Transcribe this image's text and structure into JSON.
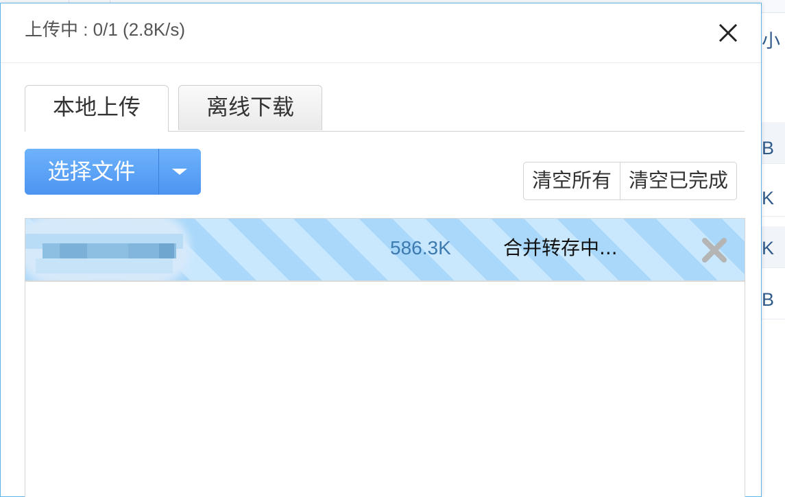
{
  "background": {
    "header_text": "小",
    "rows": [
      {
        "text": "B"
      },
      {
        "text": "K"
      },
      {
        "text": "K"
      },
      {
        "text": "B"
      }
    ]
  },
  "dialog": {
    "title": "上传中 : 0/1 (2.8K/s)",
    "close_icon": "close-icon"
  },
  "tabs": [
    {
      "label": "本地上传",
      "active": true
    },
    {
      "label": "离线下载",
      "active": false
    }
  ],
  "toolbar": {
    "choose_file_label": "选择文件",
    "dropdown_icon": "caret-down-icon",
    "clear_all_label": "清空所有",
    "clear_done_label": "清空已完成"
  },
  "files": [
    {
      "size": "586.3K",
      "status": "合并转存中...",
      "remove_icon": "remove-icon"
    }
  ],
  "colors": {
    "accent": "#4d94f2",
    "dialog_border": "#5fb4ea",
    "stripe_dark": "#a9d8fb",
    "stripe_light": "#cae8fd",
    "size_text": "#3d7ab0"
  }
}
